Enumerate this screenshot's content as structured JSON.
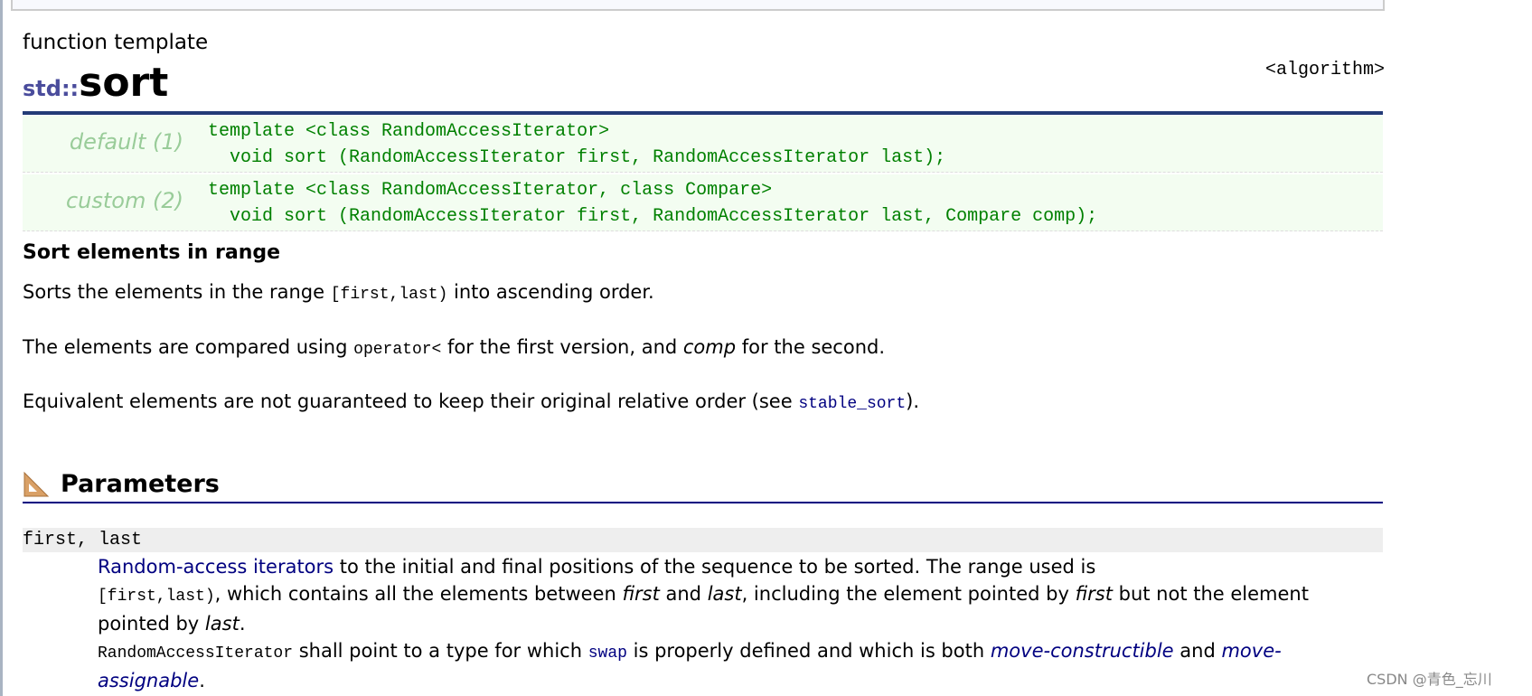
{
  "page": {
    "kind": "function template",
    "namespace": "std::",
    "name": "sort",
    "header": "<algorithm>",
    "prototypes": [
      {
        "label": "default (1)",
        "line1": "template <class RandomAccessIterator>",
        "line2": "  void sort (RandomAccessIterator first, RandomAccessIterator last);"
      },
      {
        "label": "custom (2)",
        "line1": "template <class RandomAccessIterator, class Compare>",
        "line2": "  void sort (RandomAccessIterator first, RandomAccessIterator last, Compare comp);"
      }
    ],
    "summary": "Sort elements in range",
    "p1": {
      "a": "Sorts the elements in the range ",
      "code": "[first,last)",
      "b": " into ascending order."
    },
    "p2": {
      "a": "The elements are compared using ",
      "code": "operator<",
      "b": " for the first version, and ",
      "em": "comp",
      "c": " for the second."
    },
    "p3": {
      "a": "Equivalent elements are not guaranteed to keep their original relative order (see ",
      "link": "stable_sort",
      "b": ")."
    },
    "parameters": {
      "heading": "Parameters",
      "icon": "set-square-icon",
      "name": "first, last",
      "d1_link": "Random-access iterators",
      "d1": " to the initial and final positions of the sequence to be sorted. The range used is ",
      "d2_code": "[first,last)",
      "d2": ", which contains all the elements between ",
      "d2_em1": "first",
      "d2_and": " and ",
      "d2_em2": "last",
      "d2_b": ", including the element pointed by ",
      "d2_em3": "first",
      "d2_c": " but not the element pointed by ",
      "d2_em4": "last",
      "d2_end": ".",
      "d3_code": "RandomAccessIterator",
      "d3": " shall point to a type for which ",
      "d3_link": "swap",
      "d3_b": " is properly defined and which is both ",
      "d3_link2": "move-constructible",
      "d3_c": " and ",
      "d3_link3": "move-assignable",
      "d3_end": "."
    },
    "watermark": "CSDN @青色_忘川"
  }
}
